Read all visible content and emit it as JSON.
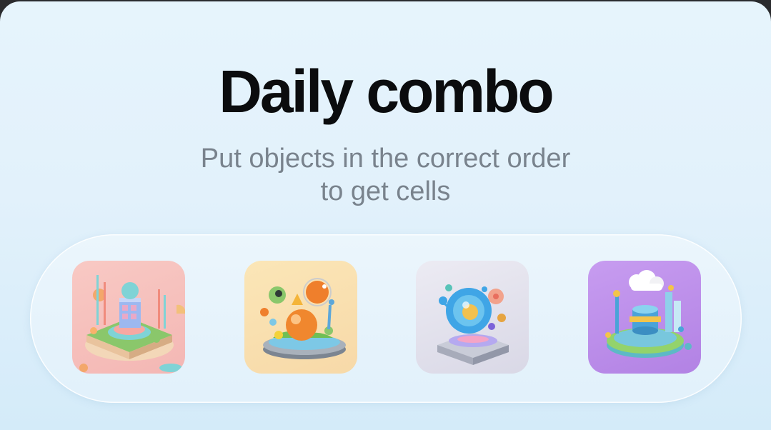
{
  "header": {
    "title": "Daily combo",
    "subtitle_line1": "Put objects in the correct order",
    "subtitle_line2": "to get cells"
  },
  "combo": {
    "tiles": [
      {
        "icon": "isometric-building-island-icon",
        "background": "#f6c0bd"
      },
      {
        "icon": "isometric-molecule-platform-icon",
        "background": "#f9e0b0"
      },
      {
        "icon": "isometric-cell-sphere-icon",
        "background": "#e3e2ee"
      },
      {
        "icon": "isometric-lab-cloud-island-icon",
        "background": "#bd8eea"
      }
    ]
  },
  "colors": {
    "title": "#0b0c0e",
    "subtitle": "#79838d",
    "background": "#e4f3fb"
  }
}
